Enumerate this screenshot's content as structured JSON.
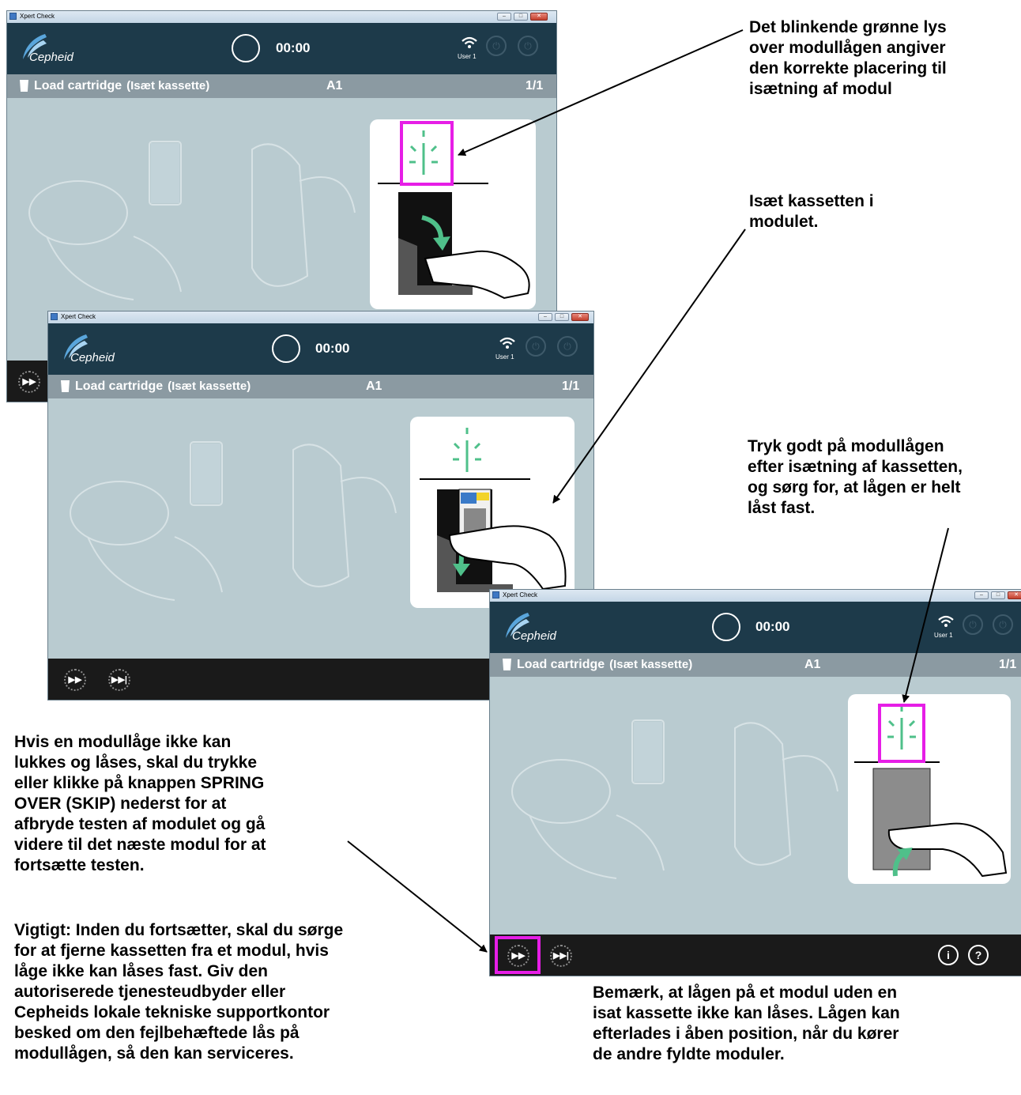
{
  "window": {
    "title": "Xpert Check",
    "minimize": "–",
    "maximize": "□",
    "close": "✕"
  },
  "header": {
    "logo": "Cepheid",
    "timer": "00:00",
    "user": "User 1"
  },
  "step": {
    "label": "Load cartridge",
    "sublabel": "(Isæt kassette)",
    "module": "A1",
    "page": "1/1"
  },
  "footer": {
    "skip": "▶▶",
    "skip_all": "▶▶|",
    "info": "i",
    "help": "?"
  },
  "annotations": {
    "blink_lines": [
      "Det blinkende grønne lys",
      "over modullågen angiver",
      "den korrekte placering til",
      "isætning af modul"
    ],
    "insert_lines": [
      "Isæt kassetten i",
      "modulet."
    ],
    "press_lines": [
      "Tryk godt på modullågen",
      "efter isætning af kassetten,",
      "og sørg for, at lågen er helt",
      "låst fast."
    ],
    "skip_lines": [
      "Hvis en modullåge ikke kan",
      "lukkes og låses, skal du trykke",
      "eller klikke på knappen SPRING",
      "OVER (SKIP) nederst for at",
      "afbryde testen af modulet og gå",
      "videre til det næste modul for at",
      "fortsætte testen."
    ],
    "important_lines": [
      "Vigtigt: Inden du fortsætter, skal du sørge",
      "for at fjerne kassetten fra et modul, hvis",
      "låge ikke kan låses fast. Giv den",
      "autoriserede tjenesteudbyder eller",
      "Cepheids lokale tekniske supportkontor",
      "besked om den fejlbehæftede lås på",
      "modullågen, så den kan serviceres."
    ],
    "note_lines": [
      "Bemærk, at lågen på et modul uden en",
      "isat kassette ikke kan låses. Lågen kan",
      "efterlades i åben position, når du kører",
      "de andre fyldte moduler."
    ]
  },
  "colors": {
    "header": "#1d3a4a",
    "titlebar": "#8b9aa2",
    "content": "#b9cbd0",
    "highlight": "#e61ee6",
    "footer": "#1a1a1a",
    "light": "#4fc08a"
  }
}
